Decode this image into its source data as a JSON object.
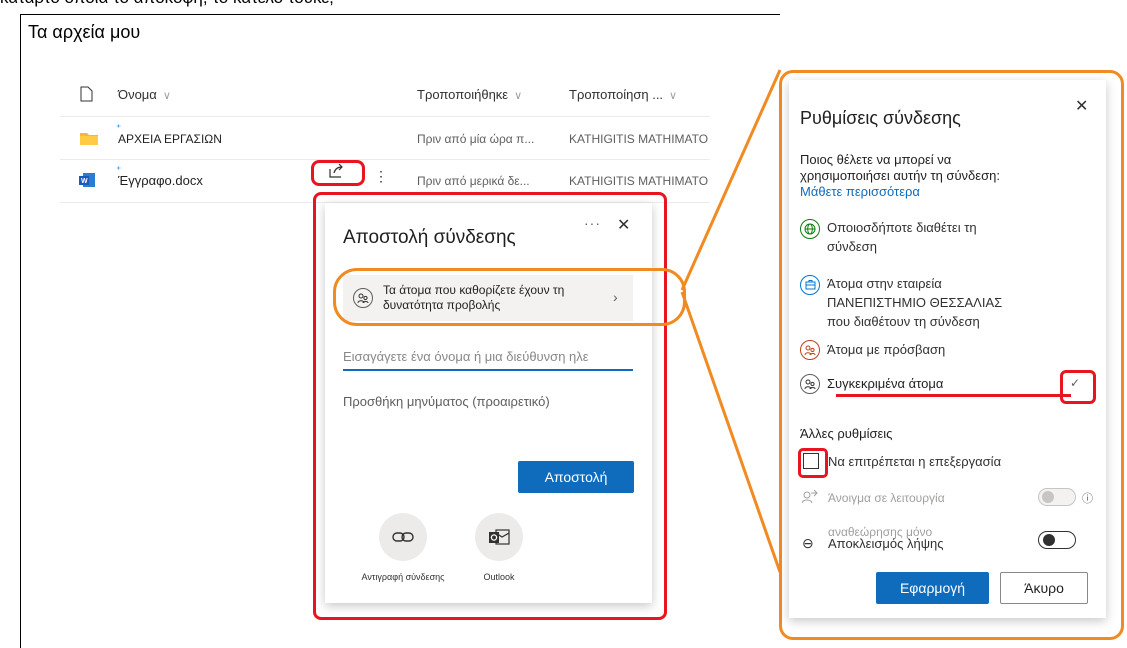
{
  "top_fragment": "κατάρτο οποία το απόκοφη, το κατέλο τουκε,",
  "page_title": "Τα αρχεία μου",
  "columns": {
    "name": "Όνομα",
    "modified": "Τροποποιήθηκε",
    "modified_by": "Τροποποίηση ..."
  },
  "files": [
    {
      "name": "ΑΡΧΕΙΑ ΕΡΓΑΣΙΩΝ",
      "modified": "Πριν από μία ώρα π...",
      "modified_by": "KATHIGITIS MATHIMATO",
      "type": "folder-icon"
    },
    {
      "name": "Έγγραφο.docx",
      "modified": "Πριν από μερικά δε...",
      "modified_by": "KATHIGITIS MATHIMATO",
      "type": "word-icon"
    }
  ],
  "send_link": {
    "title": "Αποστολή σύνδεσης",
    "more": "···",
    "close": "✕",
    "permission_text": "Τα άτομα που καθορίζετε έχουν τη δυνατότητα προβολής",
    "recipient_placeholder": "Εισαγάγετε ένα όνομα ή μια διεύθυνση ηλε",
    "message_placeholder": "Προσθήκη μηνύματος (προαιρετικό)",
    "send_button": "Αποστολή",
    "copy_link_label": "Αντιγραφή σύνδεσης",
    "outlook_label": "Outlook"
  },
  "link_settings": {
    "title": "Ρυθμίσεις σύνδεσης",
    "close": "✕",
    "question": "Ποιος θέλετε να μπορεί να χρησιμοποιήσει αυτήν τη σύνδεση:",
    "learn_more": "Μάθετε περισσότερα",
    "options": [
      {
        "label": "Οποιοσδήποτε διαθέτει τη σύνδεση",
        "icon": "globe-icon",
        "color": "#107c10"
      },
      {
        "label": "Άτομα στην εταιρεία ΠΑΝΕΠΙΣΤΗΜΙΟ ΘΕΣΣΑΛΙΑΣ που διαθέτουν τη σύνδεση",
        "icon": "building-icon",
        "color": "#0078d4"
      },
      {
        "label": "Άτομα με πρόσβαση",
        "icon": "people-access-icon",
        "color": "#c43e1c"
      },
      {
        "label": "Συγκεκριμένα άτομα",
        "icon": "specific-people-icon",
        "color": "#605e5c",
        "selected": true
      }
    ],
    "other_settings": "Άλλες ρυθμίσεις",
    "allow_edit": "Να επιτρέπεται η επεξεργασία",
    "review_mode": "Άνοιγμα σε λειτουργία",
    "review_only": "αναθεώρησης μόνο",
    "block_download": "Αποκλεισμός λήψης",
    "apply_button": "Εφαρμογή",
    "cancel_button": "Άκυρο"
  },
  "colors": {
    "accent": "#0f6cbd",
    "annotation_red": "#e8141f",
    "annotation_orange": "#f28a22"
  }
}
